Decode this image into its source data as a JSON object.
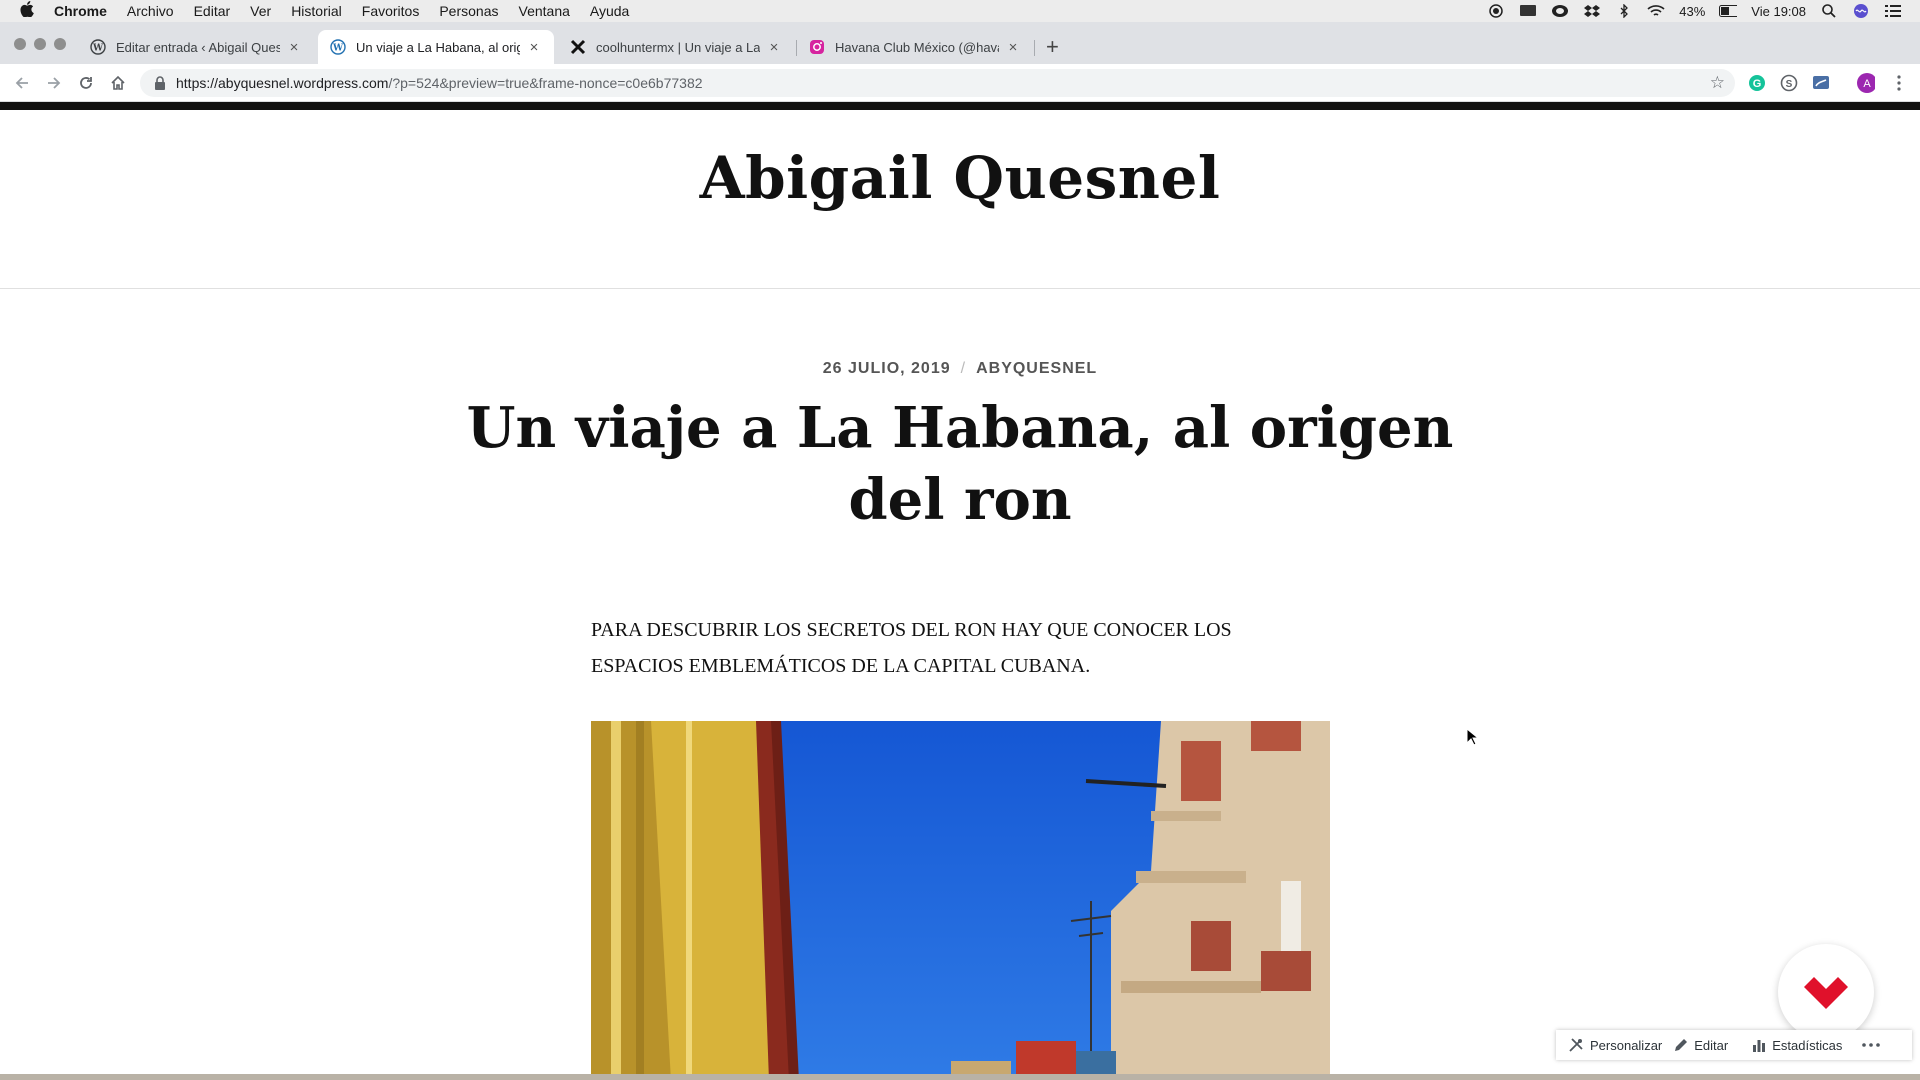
{
  "menubar": {
    "app": "Chrome",
    "items": [
      "Archivo",
      "Editar",
      "Ver",
      "Historial",
      "Favoritos",
      "Personas",
      "Ventana",
      "Ayuda"
    ],
    "battery": "43%",
    "clock": "Vie 19:08"
  },
  "tabs": [
    {
      "label": "Editar entrada ‹ Abigail Quesnel",
      "icon": "wordpress-icon"
    },
    {
      "label": "Un viaje a La Habana, al origen",
      "icon": "wordpress-icon"
    },
    {
      "label": "coolhuntermx | Un viaje a La Habana",
      "icon": "x-logo-icon"
    },
    {
      "label": "Havana Club México (@havana",
      "icon": "instagram-icon"
    }
  ],
  "omnibox": {
    "host": "https://abyquesnel.wordpress.com",
    "path": "/?p=524&preview=true&frame-nonce=c0e6b77382"
  },
  "page": {
    "site_title": "Abigail Quesnel",
    "date": "26 JULIO, 2019",
    "author": "ABYQUESNEL",
    "post_title": "Un viaje a La Habana, al origen del ron",
    "lead_line1": "PARA DESCUBRIR LOS SECRETOS DEL RON HAY QUE CONOCER LOS",
    "lead_line2": "ESPACIOS EMBLEMÁTICOS DE LA CAPITAL CUBANA."
  },
  "adminbar": {
    "customize": "Personalizar",
    "edit": "Editar",
    "stats": "Estadísticas"
  },
  "colors": {
    "tabstrip": "#dfe1e5",
    "sky": "#1e63d6",
    "fab_logo": "#e0112b",
    "avatar": "#9c27b0"
  }
}
